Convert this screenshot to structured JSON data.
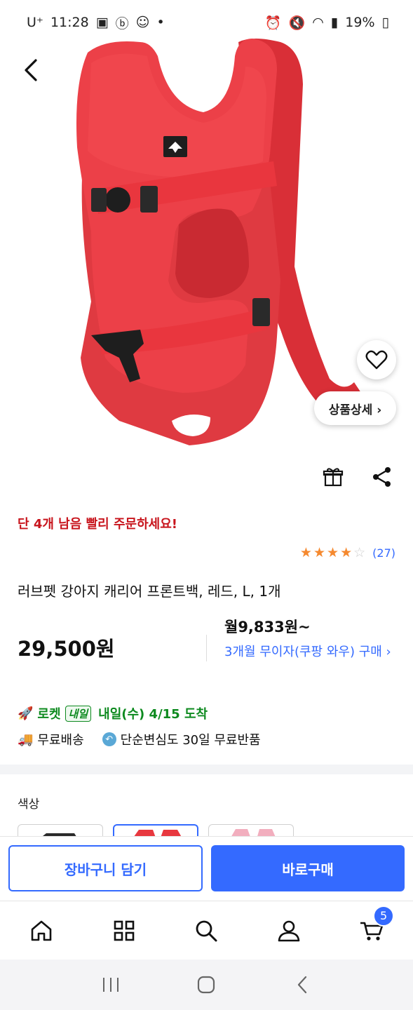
{
  "status_bar": {
    "carrier": "U⁺",
    "time": "11:28",
    "battery": "19%"
  },
  "product": {
    "stock_warning": "단 4개 남음 빨리 주문하세요!",
    "rating_stars": 4,
    "rating_max": 5,
    "review_count": "(27)",
    "title": "러브펫 강아지 캐리어 프론트백, 레드, L, 1개",
    "price": "29,500원",
    "monthly_price": "월9,833원~",
    "installment_text": "3개월 무이자(쿠팡 와우) 구매 ›"
  },
  "hero": {
    "detail_button_label": "상품상세 ›",
    "product_color": "#e8383f"
  },
  "delivery": {
    "rocket_label": "로켓",
    "rocket_badge": "내일",
    "eta": "내일(수) 4/15 도착",
    "free_shipping": "무료배송",
    "free_return": "단순변심도 30일 무료반품"
  },
  "options": {
    "color_label": "색상"
  },
  "buy_bar": {
    "cart_label": "장바구니 담기",
    "buy_label": "바로구매"
  },
  "bottom_nav": {
    "cart_count": "5"
  },
  "colors": {
    "accent": "#346aff",
    "warning": "#c8151d",
    "rocket_green": "#0d8a1f",
    "star": "#f5892f"
  }
}
